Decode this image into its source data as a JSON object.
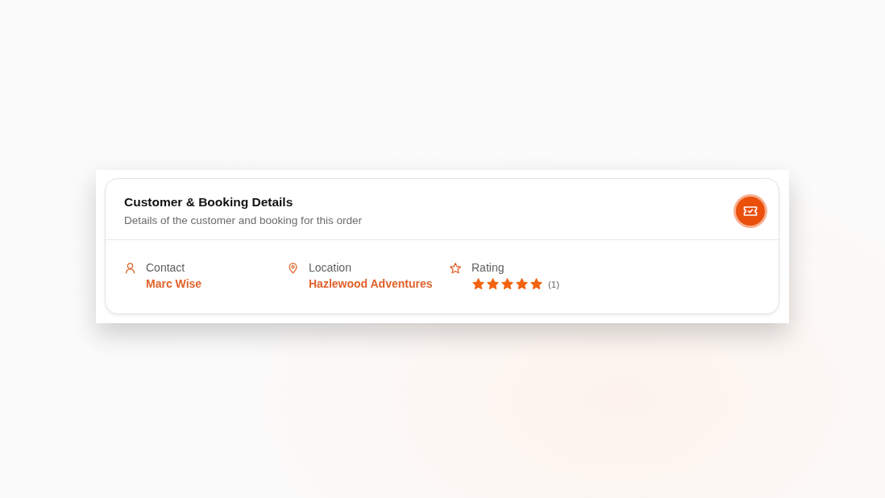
{
  "card": {
    "title": "Customer & Booking Details",
    "subtitle": "Details of the customer and booking for this order"
  },
  "fields": [
    {
      "kind": "contact",
      "label": "Contact",
      "value": "Marc Wise"
    },
    {
      "kind": "location",
      "label": "Location",
      "value": "Hazlewood Adventures"
    },
    {
      "kind": "rating",
      "label": "Rating",
      "stars": 5,
      "count": "(1)"
    }
  ]
}
